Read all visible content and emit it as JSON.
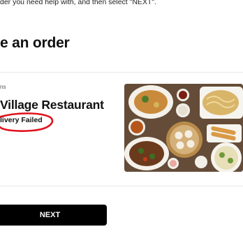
{
  "header": {
    "instruction": "der you need help with, and then select \"NEXT\".",
    "title": "e an order"
  },
  "order": {
    "items_label": "ns",
    "restaurant_name": " Village Restaurant",
    "status": "livery Failed",
    "annotation_color": "#e0121b"
  },
  "footer": {
    "next_label": "NEXT"
  },
  "colors": {
    "button_bg": "#000000",
    "button_text": "#ffffff",
    "divider": "#e8e8e8"
  }
}
